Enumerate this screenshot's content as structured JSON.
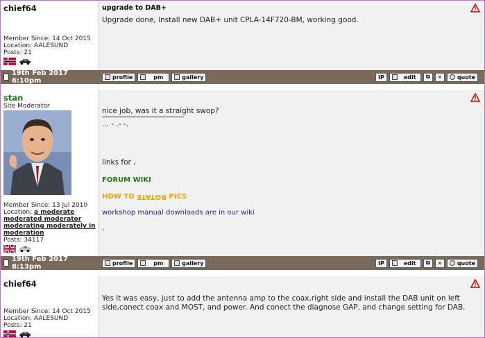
{
  "posts": [
    {
      "author": "chief64",
      "rank": "",
      "member_since": "Member Since: 14 Oct 2015",
      "location_label": "Location: AALESUND",
      "location_value": "",
      "posts": "Posts: 21",
      "subject": "upgrade to DAB+",
      "body": "Upgrade done, install new DAB+ unit CPLA-14F720-BM, working good.",
      "date": "19th Feb 2017 6:10pm"
    },
    {
      "author": "stan",
      "rank": "Site Moderator",
      "member_since": "Member Since: 13 Jul 2010",
      "location_label": "Location:",
      "location_value": "a moderate moderated moderator moderating moderately in moderation",
      "posts": "Posts: 34117",
      "body_line1": "nice job, was it a straight swop?",
      "signature_dots": "... - .- -.",
      "links_label": "links for ,",
      "forum_wiki": "FORUM WIKI",
      "how_to_a": "HOW TO ",
      "how_to_b": "ROTATE",
      "how_to_c": " PICS",
      "manual": "workshop manual downloads are in our wiki",
      "dot": ".",
      "date": "19th Feb 2017 8:13pm"
    },
    {
      "author": "chief64",
      "member_since": "Member Since: 14 Oct 2015",
      "location_label": "Location: AALESUND",
      "posts": "Posts: 21",
      "body": "Yes it was easy, just to add the antenna amp to the coax,right side and install the DAB unit on left side,conect coax and MOST, and power. And conect the diagnose GAP, and change setting for DAB."
    }
  ],
  "buttons": {
    "profile": "profile",
    "pm": "pm",
    "gallery": "gallery",
    "ip": "IP",
    "edit": "edit",
    "quote": "quote"
  },
  "colors": {
    "bar": "#7a6a5b",
    "moderator_name": "#1a7a13",
    "forum_wiki": "#1e7d12",
    "how_to": "#e8a400",
    "manual_link": "#1f2a85"
  },
  "icons": [
    "warning-icon",
    "norway-flag-icon",
    "car-icon",
    "uk-flag-icon",
    "post-document-icon",
    "profile-icon",
    "pm-icon",
    "gallery-icon",
    "edit-icon",
    "copy-icon",
    "delete-icon",
    "quote-icon"
  ]
}
